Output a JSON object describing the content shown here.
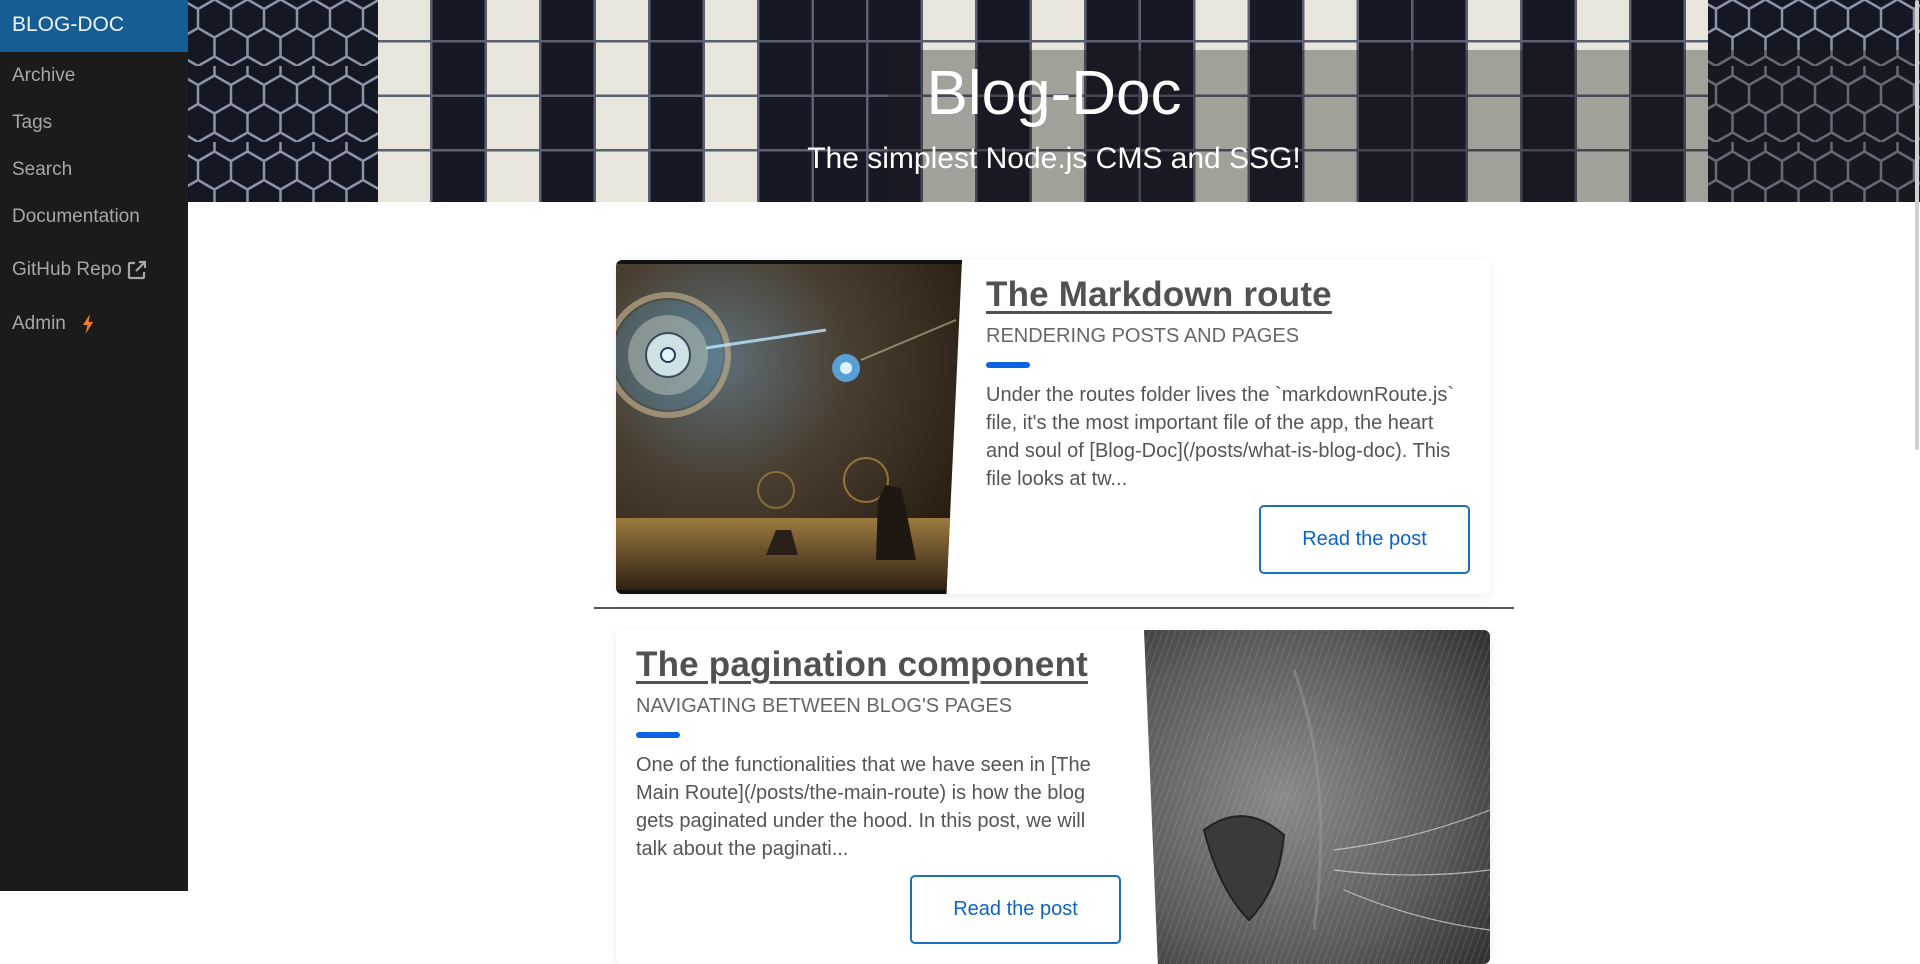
{
  "sidebar": {
    "brand": "BLOG-DOC",
    "items": [
      {
        "label": "Archive"
      },
      {
        "label": "Tags"
      },
      {
        "label": "Search"
      },
      {
        "label": "Documentation"
      },
      {
        "label": "GitHub Repo",
        "icon": "external-link-icon"
      },
      {
        "label": "Admin",
        "icon": "lightning-bolt-icon"
      }
    ]
  },
  "header": {
    "title": "Blog-Doc",
    "subtitle": "The simplest Node.js CMS and SSG!"
  },
  "colors": {
    "brand": "#155d93",
    "accent": "#0c63e4",
    "sidebar_bg": "#1b1b1c",
    "bolt": "#f57c2a"
  },
  "posts": [
    {
      "title": "The Markdown route",
      "subtitle": "RENDERING POSTS AND PAGES",
      "excerpt": "Under the routes folder lives the `markdownRoute.js` file, it's the most important file of the app, the heart and soul of [Blog-Doc](/posts/what-is-blog-doc). This file looks at tw...",
      "button": "Read the post",
      "image": "steampunk-clockwork-illustration"
    },
    {
      "title": "The pagination component",
      "subtitle": "NAVIGATING BETWEEN BLOG'S PAGES",
      "excerpt": "One of the functionalities that we have seen in [The Main Route](/posts/the-main-route) is how the blog gets paginated under the hood. In this post, we will talk about the paginati...",
      "button": "Read the post",
      "image": "black-and-white-cat-nose-closeup"
    }
  ]
}
